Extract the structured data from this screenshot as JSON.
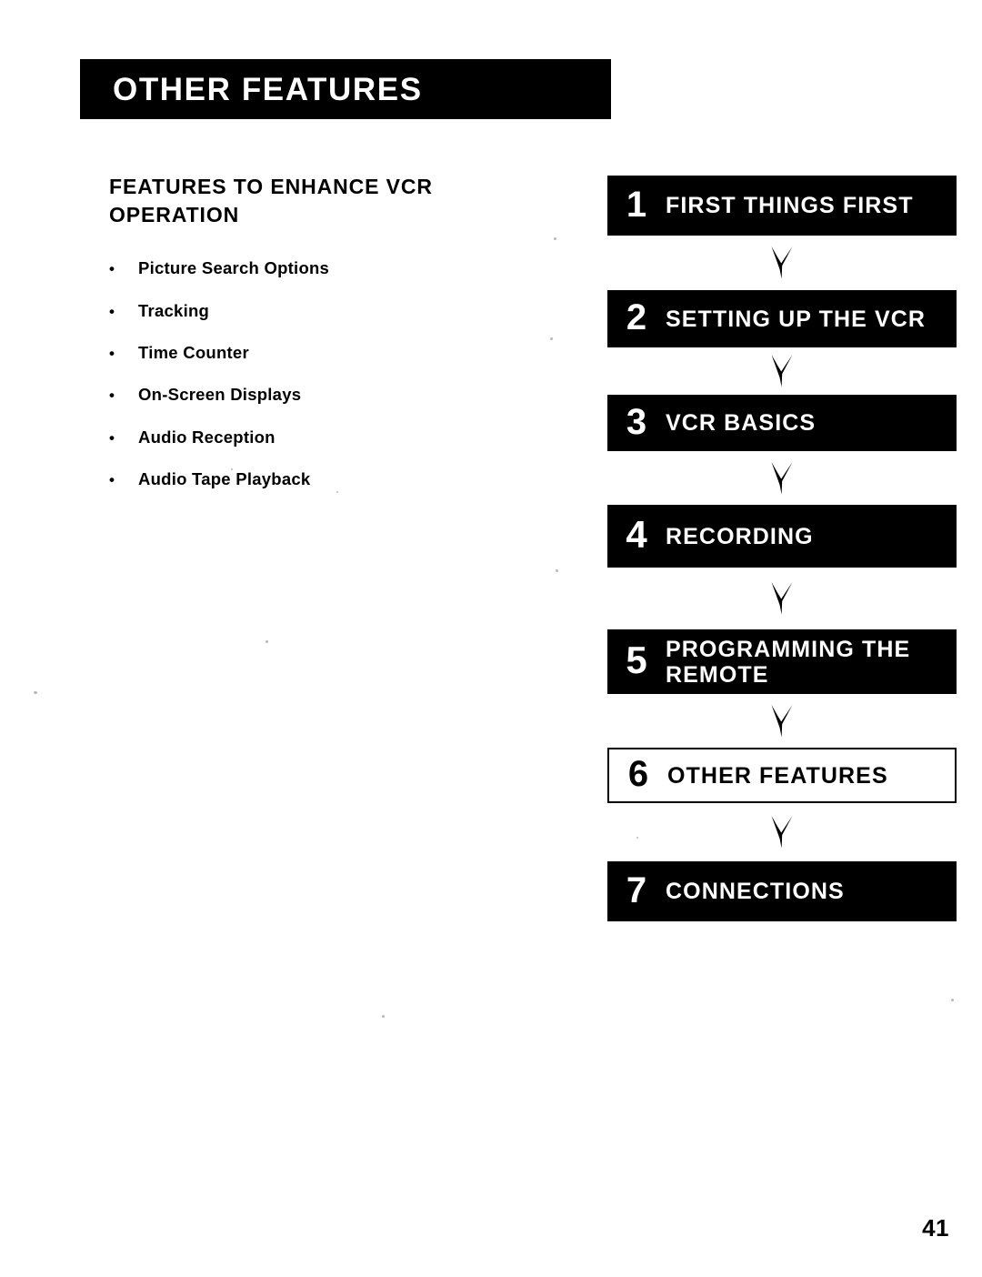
{
  "page": {
    "banner_title": "OTHER FEATURES",
    "page_number": "41",
    "ink_color": "#000000",
    "paper_color": "#ffffff"
  },
  "left_column": {
    "section_heading": "FEATURES TO ENHANCE VCR OPERATION",
    "bullet_glyph": "•",
    "features": [
      {
        "label": "Picture Search Options"
      },
      {
        "label": "Tracking"
      },
      {
        "label": "Time Counter"
      },
      {
        "label": "On-Screen Displays"
      },
      {
        "label": "Audio Reception"
      },
      {
        "label": "Audio Tape Playback"
      }
    ]
  },
  "flow_diagram": {
    "connector_icon": "down-arrow-icon",
    "steps": [
      {
        "number": "1",
        "label": "FIRST THINGS FIRST",
        "current": false
      },
      {
        "number": "2",
        "label": "SETTING UP THE VCR",
        "current": false
      },
      {
        "number": "3",
        "label": "VCR BASICS",
        "current": false
      },
      {
        "number": "4",
        "label": "RECORDING",
        "current": false
      },
      {
        "number": "5",
        "label": "PROGRAMMING THE\nREMOTE",
        "current": false
      },
      {
        "number": "6",
        "label": "OTHER FEATURES",
        "current": true
      },
      {
        "number": "7",
        "label": "CONNECTIONS",
        "current": false
      }
    ]
  }
}
